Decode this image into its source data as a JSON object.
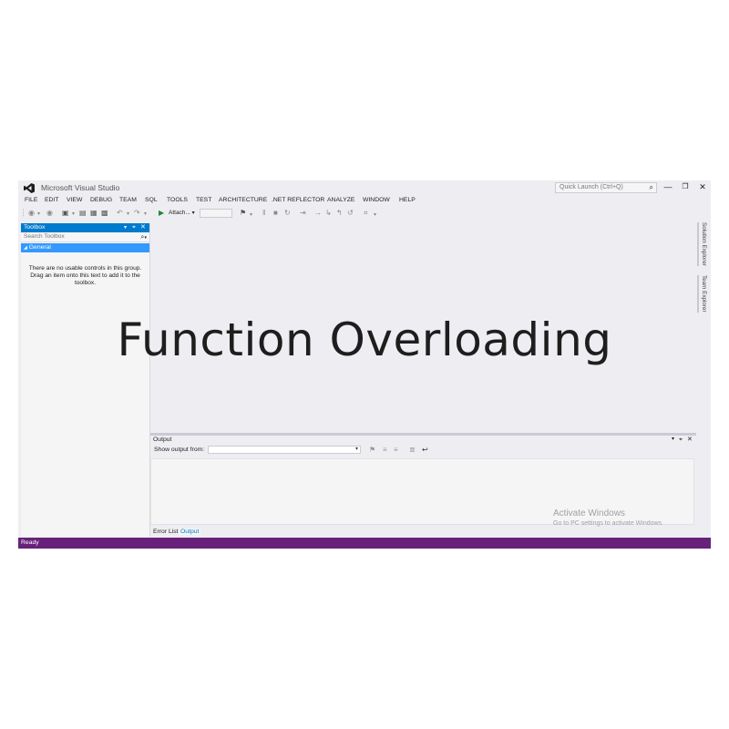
{
  "window": {
    "title": "Microsoft Visual Studio",
    "quick_launch_placeholder": "Quick Launch (Ctrl+Q)"
  },
  "menu": [
    "FILE",
    "EDIT",
    "VIEW",
    "DEBUG",
    "TEAM",
    "SQL",
    "TOOLS",
    "TEST",
    "ARCHITECTURE",
    ".NET REFLECTOR",
    "ANALYZE",
    "WINDOW",
    "HELP"
  ],
  "toolbar": {
    "attach_label": "Attach..."
  },
  "toolbox": {
    "title": "Toolbox",
    "search_placeholder": "Search Toolbox",
    "group_label": "General",
    "empty_message": "There are no usable controls in this group. Drag an item onto this text to add it to the toolbox."
  },
  "side_tabs": [
    "Solution Explorer",
    "Team Explorer"
  ],
  "output": {
    "title": "Output",
    "show_from_label": "Show output from:",
    "tabs": [
      "Error List",
      "Output"
    ]
  },
  "watermark": {
    "title": "Activate Windows",
    "subtitle": "Go to PC settings to activate Windows."
  },
  "status": "Ready",
  "overlay_title": "Function Overloading",
  "colors": {
    "accent": "#007acc",
    "status_bar": "#68217a",
    "group_highlight": "#3399ff",
    "ide_background": "#eeeef2"
  }
}
